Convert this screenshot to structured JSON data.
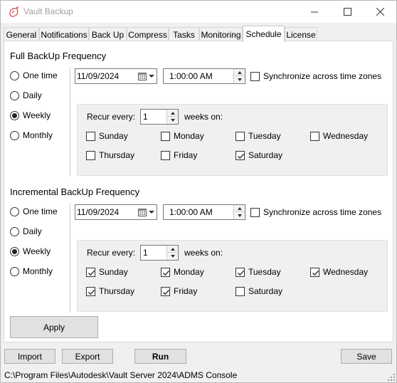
{
  "window": {
    "title": "Vault Backup",
    "brand_color": "#d9534f"
  },
  "tabs": [
    {
      "label": "General"
    },
    {
      "label": "Notifications"
    },
    {
      "label": "Back Up"
    },
    {
      "label": "Compress"
    },
    {
      "label": "Tasks"
    },
    {
      "label": "Monitoring"
    },
    {
      "label": "Schedule",
      "active": true
    },
    {
      "label": "License"
    }
  ],
  "full": {
    "title": "Full BackUp Frequency",
    "frequency_options": [
      "One time",
      "Daily",
      "Weekly",
      "Monthly"
    ],
    "selected_frequency": "Weekly",
    "date": "11/09/2024",
    "time": "1:00:00 AM",
    "sync_label": "Synchronize across time zones",
    "sync_checked": false,
    "recur_label": "Recur every:",
    "recur_value": "1",
    "weeks_on_label": "weeks on:",
    "days": [
      {
        "label": "Sunday",
        "checked": false
      },
      {
        "label": "Monday",
        "checked": false
      },
      {
        "label": "Tuesday",
        "checked": false
      },
      {
        "label": "Wednesday",
        "checked": false
      },
      {
        "label": "Thursday",
        "checked": false
      },
      {
        "label": "Friday",
        "checked": false
      },
      {
        "label": "Saturday",
        "checked": true
      }
    ]
  },
  "incremental": {
    "title": "Incremental BackUp Frequency",
    "frequency_options": [
      "One time",
      "Daily",
      "Weekly",
      "Monthly"
    ],
    "selected_frequency": "Weekly",
    "date": "11/09/2024",
    "time": "1:00:00 AM",
    "sync_label": "Synchronize across time zones",
    "sync_checked": false,
    "recur_label": "Recur every:",
    "recur_value": "1",
    "weeks_on_label": "weeks on:",
    "days": [
      {
        "label": "Sunday",
        "checked": true
      },
      {
        "label": "Monday",
        "checked": true
      },
      {
        "label": "Tuesday",
        "checked": true
      },
      {
        "label": "Wednesday",
        "checked": true
      },
      {
        "label": "Thursday",
        "checked": true
      },
      {
        "label": "Friday",
        "checked": true
      },
      {
        "label": "Saturday",
        "checked": false
      }
    ]
  },
  "buttons": {
    "apply": "Apply",
    "import": "Import",
    "export": "Export",
    "run": "Run",
    "save": "Save"
  },
  "status": {
    "path": "C:\\Program Files\\Autodesk\\Vault Server 2024\\ADMS Console"
  }
}
